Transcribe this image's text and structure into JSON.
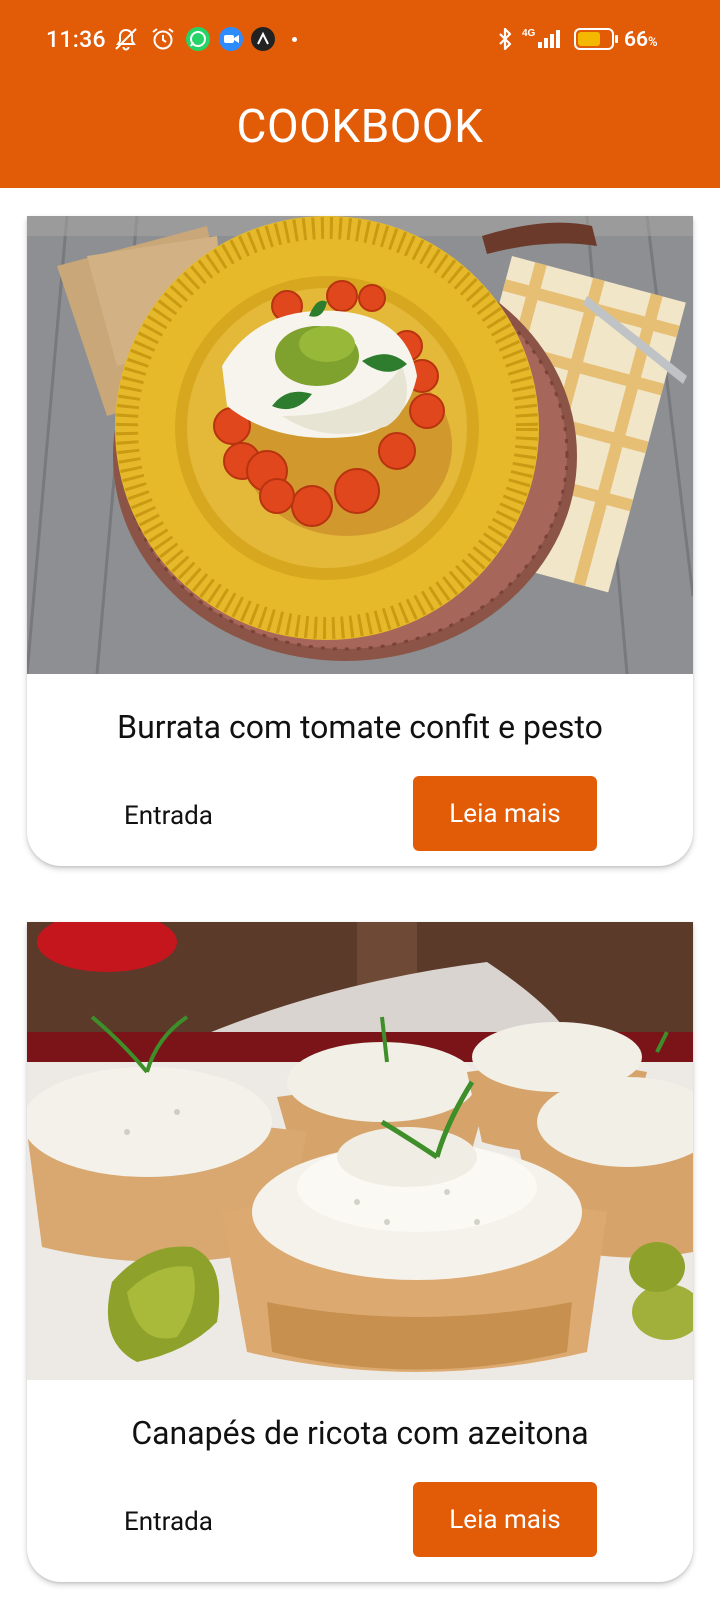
{
  "status_bar": {
    "time": "11:36",
    "network": "4G",
    "battery_percent": "66",
    "battery_unit": "%",
    "icons": [
      "notifications-off-icon",
      "alarm-icon",
      "whatsapp-icon",
      "video-call-icon",
      "app-notification-icon",
      "bluetooth-icon",
      "signal-icon",
      "battery-icon"
    ]
  },
  "app_bar": {
    "title": "COOKBOOK"
  },
  "recipes": [
    {
      "title": "Burrata com tomate confit e pesto",
      "category": "Entrada",
      "button_label": "Leia mais"
    },
    {
      "title": "Canapés de ricota com azeitona",
      "category": "Entrada",
      "button_label": "Leia mais"
    }
  ],
  "colors": {
    "primary": "#E25B07",
    "background": "#FFFFFF",
    "text": "#111111"
  }
}
